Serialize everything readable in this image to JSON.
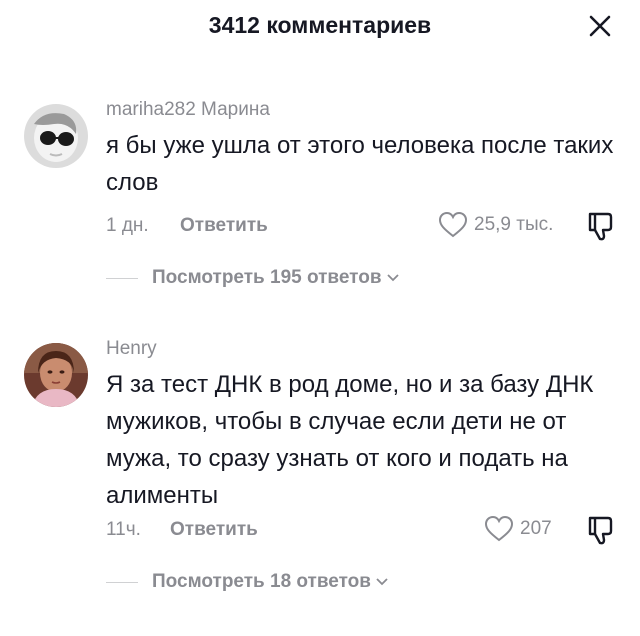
{
  "header": {
    "title": "3412 комментариев",
    "close_icon": "close-icon"
  },
  "comments": [
    {
      "username": "mariha282 Марина",
      "text": "я бы уже ушла от этого человека после таких слов",
      "time": "1 дн.",
      "reply_label": "Ответить",
      "likes": "25,9 тыс.",
      "view_replies": "Посмотреть 195 ответов"
    },
    {
      "username": "Henry",
      "text": "Я за тест ДНК в род доме, но и за базу ДНК мужиков, чтобы в случае если дети не от мужа, то сразу узнать от кого и подать на алименты",
      "time": "11ч.",
      "reply_label": "Ответить",
      "likes": "207",
      "view_replies": "Посмотреть 18 ответов"
    }
  ],
  "colors": {
    "text_primary": "#161823",
    "text_secondary": "#8a8b91",
    "divider": "#d0d1d3"
  }
}
